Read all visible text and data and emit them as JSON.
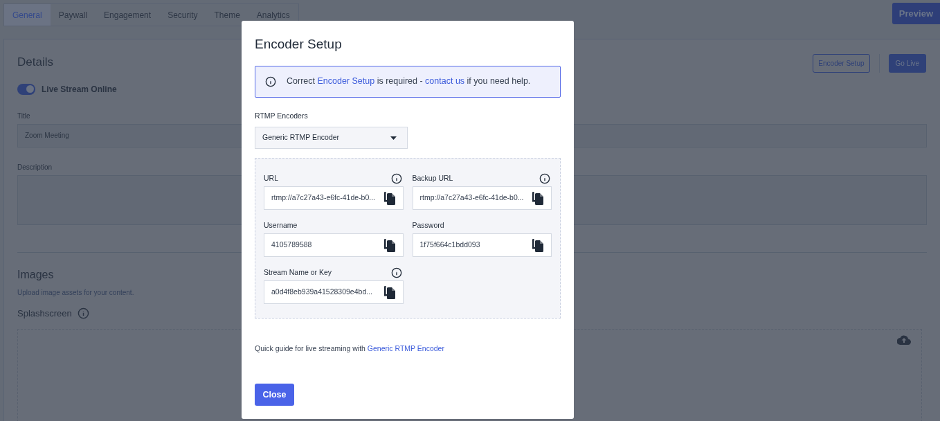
{
  "tabs": [
    {
      "label": "General",
      "selected": true
    },
    {
      "label": "Paywall",
      "selected": false
    },
    {
      "label": "Engagement",
      "selected": false
    },
    {
      "label": "Security",
      "selected": false
    },
    {
      "label": "Theme",
      "selected": false
    },
    {
      "label": "Analytics",
      "selected": false
    }
  ],
  "preview_button": "Preview",
  "details": {
    "heading": "Details",
    "encoder_button": "Encoder Setup",
    "go_live_button": "Go Live",
    "toggle": {
      "label": "Live Stream Online",
      "on": true
    },
    "title_label": "Title",
    "title_value": "Zoom Meeting",
    "description_label": "Description"
  },
  "images": {
    "heading": "Images",
    "subtitle": "Upload image assets for your content.",
    "splashscreen_label": "Splashscreen"
  },
  "modal": {
    "title": "Encoder Setup",
    "alert": [
      {
        "kind": "text",
        "text": "Correct "
      },
      {
        "kind": "link",
        "text": "Encoder Setup"
      },
      {
        "kind": "text",
        "text": " is required - "
      },
      {
        "kind": "link",
        "text": "contact us"
      },
      {
        "kind": "text",
        "text": " if you need help."
      }
    ],
    "encoders_label": "RTMP Encoders",
    "encoder_value": "Generic RTMP Encoder",
    "fields": [
      {
        "label": "URL",
        "info": true,
        "value": "rtmp://a7c27a43-e6fc-41de-b0..."
      },
      {
        "label": "Backup URL",
        "info": true,
        "value": "rtmp://a7c27a43-e6fc-41de-b0..."
      },
      {
        "label": "Username",
        "info": false,
        "value": "4105789588"
      },
      {
        "label": "Password",
        "info": false,
        "value": "1f75f664c1bdd093"
      },
      {
        "label": "Stream Name or Key",
        "info": true,
        "value": "a0d4f8eb939a41528309e4bd..."
      }
    ],
    "guide_text": "Quick guide for live streaming with ",
    "guide_link": "Generic RTMP Encoder",
    "close_button": "Close"
  }
}
